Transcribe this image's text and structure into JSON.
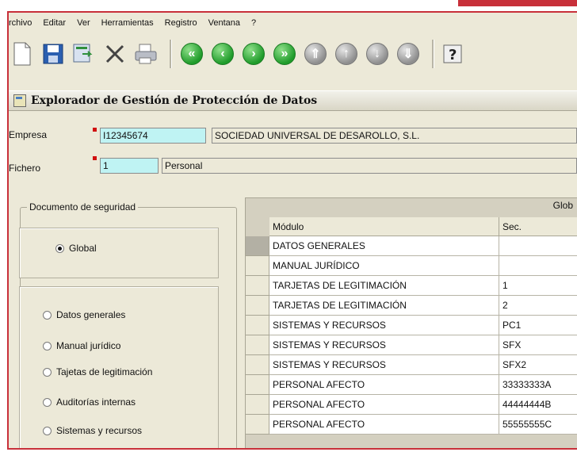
{
  "menu": [
    "rchivo",
    "Editar",
    "Ver",
    "Herramientas",
    "Registro",
    "Ventana",
    "?"
  ],
  "toolbar": {
    "icons": [
      "new-document",
      "save-disk",
      "export",
      "delete-x",
      "print",
      "first-record",
      "previous-record",
      "next-record",
      "last-record",
      "top-record",
      "up-record",
      "down-record",
      "bottom-record",
      "help"
    ]
  },
  "window": {
    "title": "Explorador de Gestión de Protección de Datos"
  },
  "form": {
    "empresa_label": "Empresa",
    "empresa_code": "I12345674",
    "empresa_name": "SOCIEDAD UNIVERSAL DE DESAROLLO, S.L.",
    "fichero_label": "Fichero",
    "fichero_code": "1",
    "fichero_name": "Personal"
  },
  "security_doc": {
    "title": "Documento de seguridad",
    "global_label": "Global",
    "options": [
      "Datos generales",
      "Manual jurídico",
      "Tajetas de legitimación",
      "Auditorías internas",
      "Sistemas y recursos"
    ]
  },
  "grid": {
    "title": "Glob",
    "columns": [
      "Módulo",
      "Sec."
    ],
    "rows": [
      [
        "DATOS GENERALES",
        ""
      ],
      [
        "MANUAL JURÍDICO",
        ""
      ],
      [
        "TARJETAS DE LEGITIMACIÓN",
        "1"
      ],
      [
        "TARJETAS DE LEGITIMACIÓN",
        "2"
      ],
      [
        "SISTEMAS Y RECURSOS",
        "PC1"
      ],
      [
        "SISTEMAS Y RECURSOS",
        "SFX"
      ],
      [
        "SISTEMAS Y RECURSOS",
        "SFX2"
      ],
      [
        "PERSONAL AFECTO",
        "33333333A"
      ],
      [
        "PERSONAL AFECTO",
        "44444444B"
      ],
      [
        "PERSONAL AFECTO",
        "55555555C"
      ]
    ]
  },
  "colors": {
    "accent": "#c8303a",
    "required": "#d01010",
    "key_field": "#bff3f3",
    "nav_button": "#1f9b2a"
  }
}
